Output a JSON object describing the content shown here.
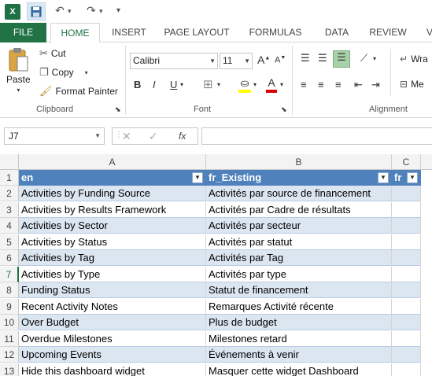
{
  "app": {
    "logo": "X",
    "colors": {
      "accent": "#217346",
      "table_header": "#4f81bd",
      "band": "#dce6f1"
    }
  },
  "qat": {
    "save_icon": "save-icon",
    "undo_icon": "undo-icon",
    "redo_icon": "redo-icon"
  },
  "tabs": [
    "FILE",
    "HOME",
    "INSERT",
    "PAGE LAYOUT",
    "FORMULAS",
    "DATA",
    "REVIEW",
    "V"
  ],
  "clipboard": {
    "paste": "Paste",
    "cut": "Cut",
    "copy": "Copy",
    "format_painter": "Format Painter",
    "label": "Clipboard"
  },
  "font": {
    "name": "Calibri",
    "size": "11",
    "bold": "B",
    "italic": "I",
    "underline": "U",
    "grow": "A",
    "shrink": "A",
    "font_color": "A",
    "label": "Font"
  },
  "alignment": {
    "wrap": "Wra",
    "merge": "Me",
    "label": "Alignment"
  },
  "formula_bar": {
    "name_box": "J7",
    "fx": "fx",
    "value": ""
  },
  "grid": {
    "columns": [
      "A",
      "B",
      "C"
    ],
    "header_row": {
      "num": "1",
      "a": "en",
      "b": "fr_Existing",
      "c": "fr"
    },
    "rows": [
      {
        "num": "2",
        "a": "Activities by Funding Source",
        "b": "Activités par source de financement"
      },
      {
        "num": "3",
        "a": "Activities by Results Framework",
        "b": "Activités par Cadre de résultats"
      },
      {
        "num": "4",
        "a": "Activities by Sector",
        "b": "Activités par secteur"
      },
      {
        "num": "5",
        "a": "Activities by Status",
        "b": "Activités par statut"
      },
      {
        "num": "6",
        "a": "Activities by Tag",
        "b": "Activités par Tag"
      },
      {
        "num": "7",
        "a": "Activities by Type",
        "b": "Activités par type"
      },
      {
        "num": "8",
        "a": "Funding Status",
        "b": "Statut de financement"
      },
      {
        "num": "9",
        "a": "Recent Activity Notes",
        "b": "Remarques Activité récente"
      },
      {
        "num": "10",
        "a": "Over Budget",
        "b": "Plus de budget"
      },
      {
        "num": "11",
        "a": "Overdue Milestones",
        "b": "Milestones retard"
      },
      {
        "num": "12",
        "a": "Upcoming Events",
        "b": "Événements à venir"
      },
      {
        "num": "13",
        "a": "Hide this dashboard widget",
        "b": "Masquer cette widget Dashboard"
      }
    ]
  }
}
